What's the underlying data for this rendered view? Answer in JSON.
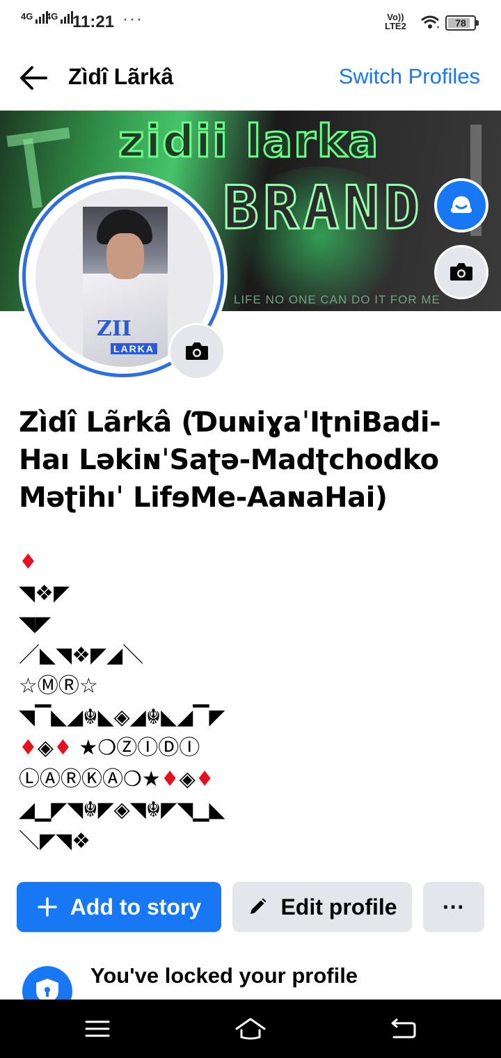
{
  "status_bar": {
    "sim1": "4G",
    "sim2": "4G",
    "time": "11:21",
    "more": "···",
    "volte_top": "Vo))",
    "volte_bottom": "LTE2",
    "battery": "78"
  },
  "header": {
    "title": "Zìdî Lãrkâ",
    "switch_label": "Switch Profiles"
  },
  "cover": {
    "title": "zidii larka",
    "subtitle": "BRAND",
    "tagline": "LIFE NO ONE CAN DO IT FOR ME"
  },
  "profile_photo": {
    "logo_text": "ZII",
    "logo_sub": "LARKA"
  },
  "profile": {
    "name": "Zìdî Lãrkâ (ƊuɴiɣaˈIʈniBadi-Haı LəkiɴˈSaʈə-Madʈchodko Məʈihıˈ LifɘMe-AaɴaHai)",
    "bio_lines": [
      "♦",
      "◥❖◤",
      "◥◤",
      "／◣◥❖◤◢＼",
      "☆ⓂⓇ☆",
      "◥▔◣◢☬◣◈◢☬◣◢▔◤",
      "♦◈♦ ★❍ⓏⒾⒹⒾ",
      "ⓁⒶⓇⓀⒶ❍★♦◈♦",
      "◢▁◤◥☬◤◈◥☬◤◥▁◣",
      "＼◤◥❖"
    ]
  },
  "actions": {
    "add_story": "Add to story",
    "edit_profile": "Edit profile",
    "more": "···"
  },
  "lock_notice": {
    "title": "You've locked your profile"
  },
  "colors": {
    "accent": "#1877f2",
    "button_gray": "#e4e6eb"
  }
}
